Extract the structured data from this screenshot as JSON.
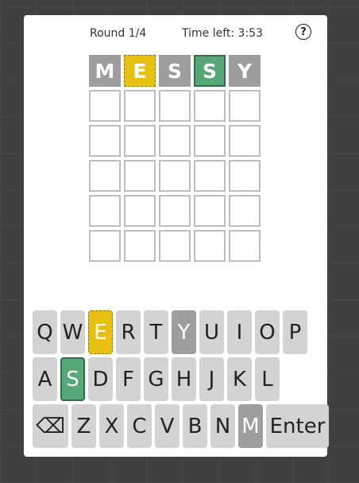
{
  "header": {
    "round": "Round 1/4",
    "timer": "Time left: 3:53",
    "help_icon": "question-circle-icon",
    "help_symbol": "?"
  },
  "board": {
    "rows": [
      [
        {
          "letter": "M",
          "state": "absent"
        },
        {
          "letter": "E",
          "state": "present"
        },
        {
          "letter": "S",
          "state": "absent"
        },
        {
          "letter": "S",
          "state": "correct"
        },
        {
          "letter": "Y",
          "state": "absent"
        }
      ],
      [
        {
          "letter": "",
          "state": "empty"
        },
        {
          "letter": "",
          "state": "empty"
        },
        {
          "letter": "",
          "state": "empty"
        },
        {
          "letter": "",
          "state": "empty"
        },
        {
          "letter": "",
          "state": "empty"
        }
      ],
      [
        {
          "letter": "",
          "state": "empty"
        },
        {
          "letter": "",
          "state": "empty"
        },
        {
          "letter": "",
          "state": "empty"
        },
        {
          "letter": "",
          "state": "empty"
        },
        {
          "letter": "",
          "state": "empty"
        }
      ],
      [
        {
          "letter": "",
          "state": "empty"
        },
        {
          "letter": "",
          "state": "empty"
        },
        {
          "letter": "",
          "state": "empty"
        },
        {
          "letter": "",
          "state": "empty"
        },
        {
          "letter": "",
          "state": "empty"
        }
      ],
      [
        {
          "letter": "",
          "state": "empty"
        },
        {
          "letter": "",
          "state": "empty"
        },
        {
          "letter": "",
          "state": "empty"
        },
        {
          "letter": "",
          "state": "empty"
        },
        {
          "letter": "",
          "state": "empty"
        }
      ],
      [
        {
          "letter": "",
          "state": "empty"
        },
        {
          "letter": "",
          "state": "empty"
        },
        {
          "letter": "",
          "state": "empty"
        },
        {
          "letter": "",
          "state": "empty"
        },
        {
          "letter": "",
          "state": "empty"
        }
      ]
    ]
  },
  "keyboard": {
    "rows": [
      [
        {
          "label": "Q",
          "state": "unused"
        },
        {
          "label": "W",
          "state": "unused"
        },
        {
          "label": "E",
          "state": "present"
        },
        {
          "label": "R",
          "state": "unused"
        },
        {
          "label": "T",
          "state": "unused"
        },
        {
          "label": "Y",
          "state": "absent"
        },
        {
          "label": "U",
          "state": "unused"
        },
        {
          "label": "I",
          "state": "unused"
        },
        {
          "label": "O",
          "state": "unused"
        },
        {
          "label": "P",
          "state": "unused"
        }
      ],
      [
        {
          "label": "A",
          "state": "unused"
        },
        {
          "label": "S",
          "state": "correct"
        },
        {
          "label": "D",
          "state": "unused"
        },
        {
          "label": "F",
          "state": "unused"
        },
        {
          "label": "G",
          "state": "unused"
        },
        {
          "label": "H",
          "state": "unused"
        },
        {
          "label": "J",
          "state": "unused"
        },
        {
          "label": "K",
          "state": "unused"
        },
        {
          "label": "L",
          "state": "unused"
        }
      ],
      [
        {
          "label": "⌫",
          "state": "unused",
          "kind": "backspace",
          "icon": "backspace-icon"
        },
        {
          "label": "Z",
          "state": "unused"
        },
        {
          "label": "X",
          "state": "unused"
        },
        {
          "label": "C",
          "state": "unused"
        },
        {
          "label": "V",
          "state": "unused"
        },
        {
          "label": "B",
          "state": "unused"
        },
        {
          "label": "N",
          "state": "unused"
        },
        {
          "label": "M",
          "state": "absent"
        },
        {
          "label": "Enter",
          "state": "unused",
          "kind": "enter"
        }
      ]
    ]
  },
  "colors": {
    "absent": "#9e9e9e",
    "present": "#e7c111",
    "correct": "#58a778",
    "key_default": "#d3d3d3"
  }
}
